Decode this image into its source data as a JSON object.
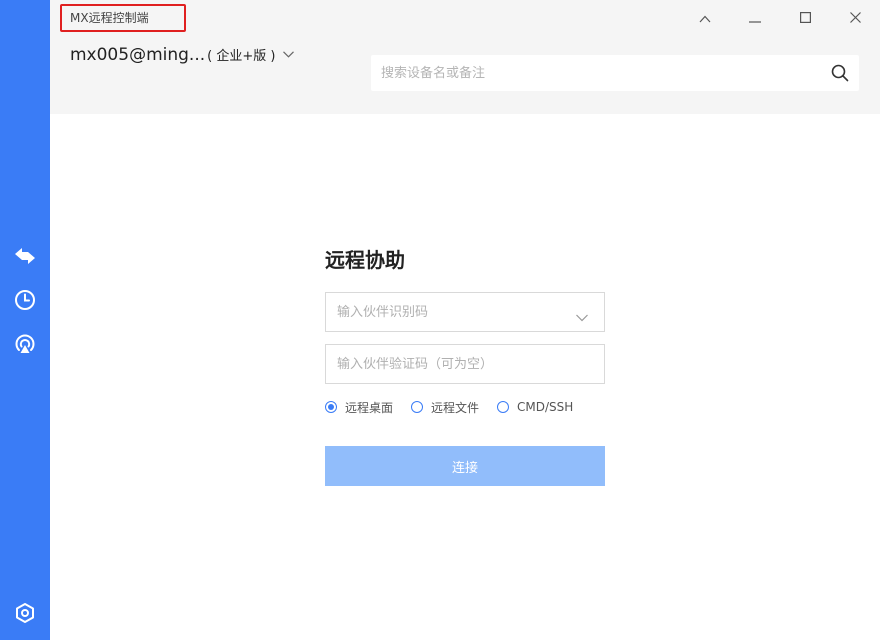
{
  "window": {
    "title": "MX远程控制端"
  },
  "header": {
    "account_name": "mx005@ming...",
    "account_edition": "( 企业+版 )",
    "search_placeholder": "搜索设备名或备注"
  },
  "sidebar": {
    "items": [
      {
        "icon": "swap-arrows-icon"
      },
      {
        "icon": "clock-icon"
      },
      {
        "icon": "broadcast-icon"
      },
      {
        "icon": "settings-hexagon-icon"
      }
    ]
  },
  "main": {
    "title": "远程协助",
    "partner_id_placeholder": "输入伙伴识别码",
    "partner_code_placeholder": "输入伙伴验证码（可为空）",
    "modes": [
      {
        "label": "远程桌面",
        "selected": true
      },
      {
        "label": "远程文件",
        "selected": false
      },
      {
        "label": "CMD/SSH",
        "selected": false
      }
    ],
    "connect_label": "连接"
  },
  "colors": {
    "sidebar": "#3a7cf6",
    "accent": "#3a7cf6",
    "connect_button": "#91bdfb",
    "header_bg": "#f5f5f5",
    "title_highlight": "#e02020"
  }
}
